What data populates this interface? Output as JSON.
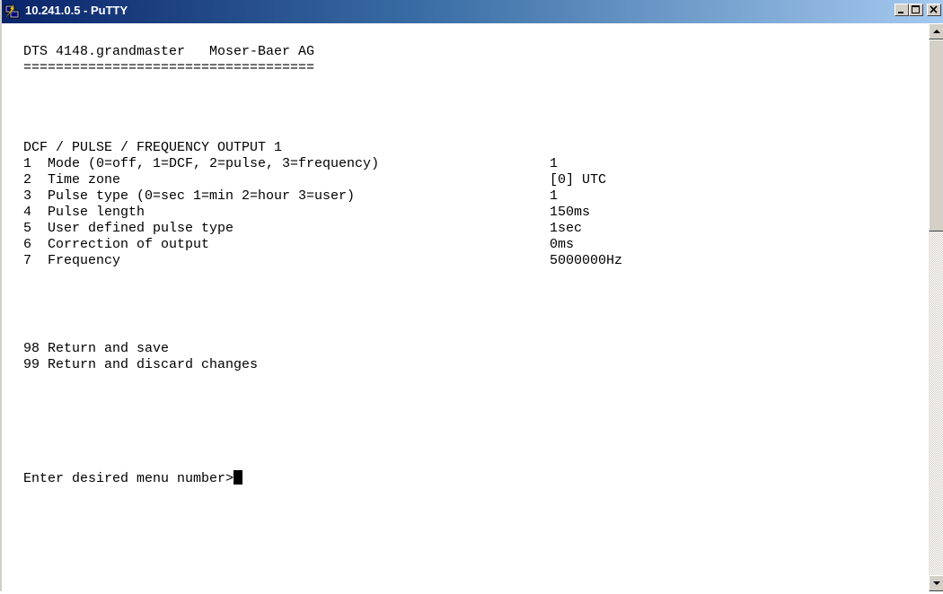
{
  "window": {
    "title": "10.241.0.5 - PuTTY",
    "icon": "putty-icon"
  },
  "terminal": {
    "header": "DTS 4148.grandmaster   Moser-Baer AG",
    "separator": "====================================",
    "section_title": "DCF / PULSE / FREQUENCY OUTPUT 1",
    "settings": [
      {
        "label": "1  Mode (0=off, 1=DCF, 2=pulse, 3=frequency)",
        "value": "1"
      },
      {
        "label": "2  Time zone",
        "value": "[0] UTC"
      },
      {
        "label": "3  Pulse type (0=sec 1=min 2=hour 3=user)",
        "value": "1"
      },
      {
        "label": "4  Pulse length",
        "value": "150ms"
      },
      {
        "label": "5  User defined pulse type",
        "value": "1sec"
      },
      {
        "label": "6  Correction of output",
        "value": "0ms"
      },
      {
        "label": "7  Frequency",
        "value": "5000000Hz"
      }
    ],
    "options": [
      "98 Return and save",
      "99 Return and discard changes"
    ],
    "prompt": "Enter desired menu number>"
  },
  "colors": {
    "title_bar_start": "#0a246a",
    "title_bar_end": "#a6caf0",
    "terminal_background": "#ffffff",
    "terminal_text": "#000000"
  }
}
